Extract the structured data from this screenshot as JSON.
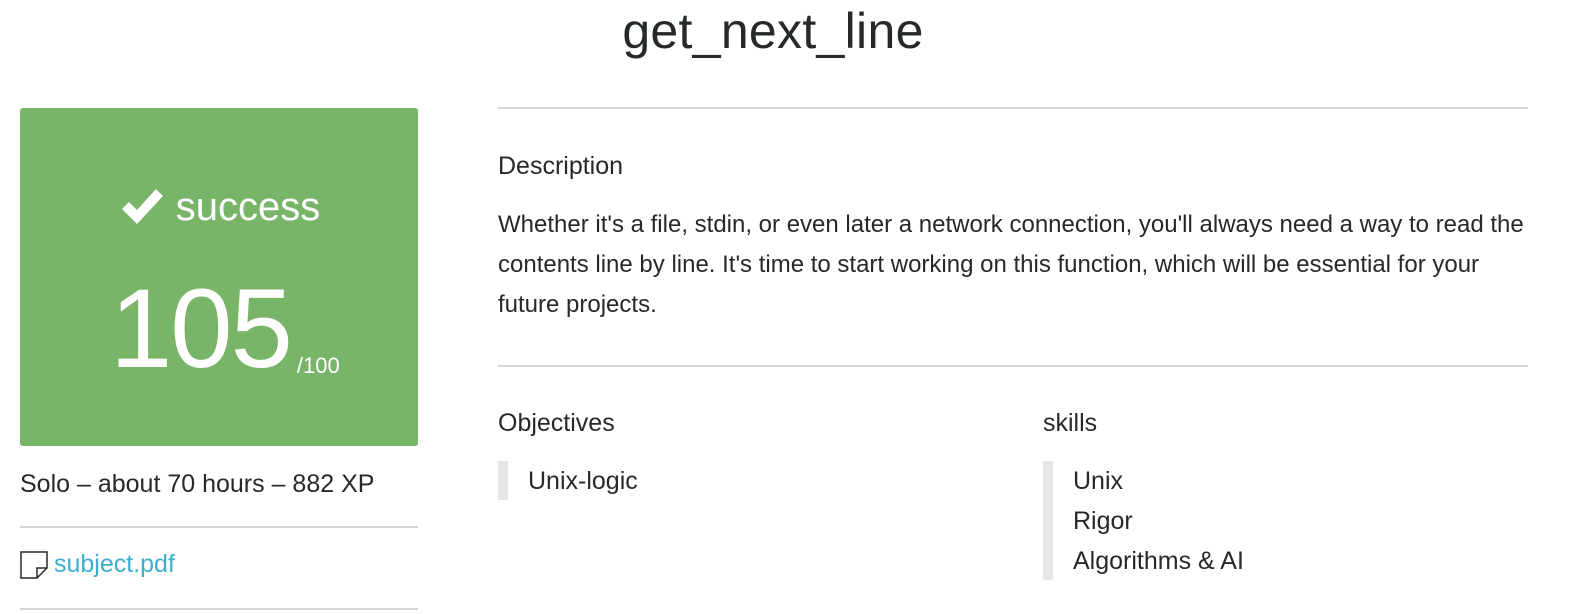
{
  "page": {
    "title": "get_next_line"
  },
  "result": {
    "status": "success",
    "score": "105",
    "max": "/100",
    "status_icon": "checkmark-icon",
    "color": "#78b569"
  },
  "meta": {
    "info": "Solo – about 70 hours – 882 XP"
  },
  "attachment": {
    "icon": "document-icon",
    "label": "subject.pdf",
    "link_color": "#3faecc"
  },
  "description": {
    "heading": "Description",
    "text": "Whether it's a file, stdin, or even later a network connection, you'll always need a way to read the contents line by line. It's time to start working on this function, which will be essential for your future projects."
  },
  "objectives": {
    "heading": "Objectives",
    "items": [
      "Unix-logic"
    ]
  },
  "skills": {
    "heading": "skills",
    "items": [
      "Unix",
      "Rigor",
      "Algorithms & AI"
    ]
  }
}
